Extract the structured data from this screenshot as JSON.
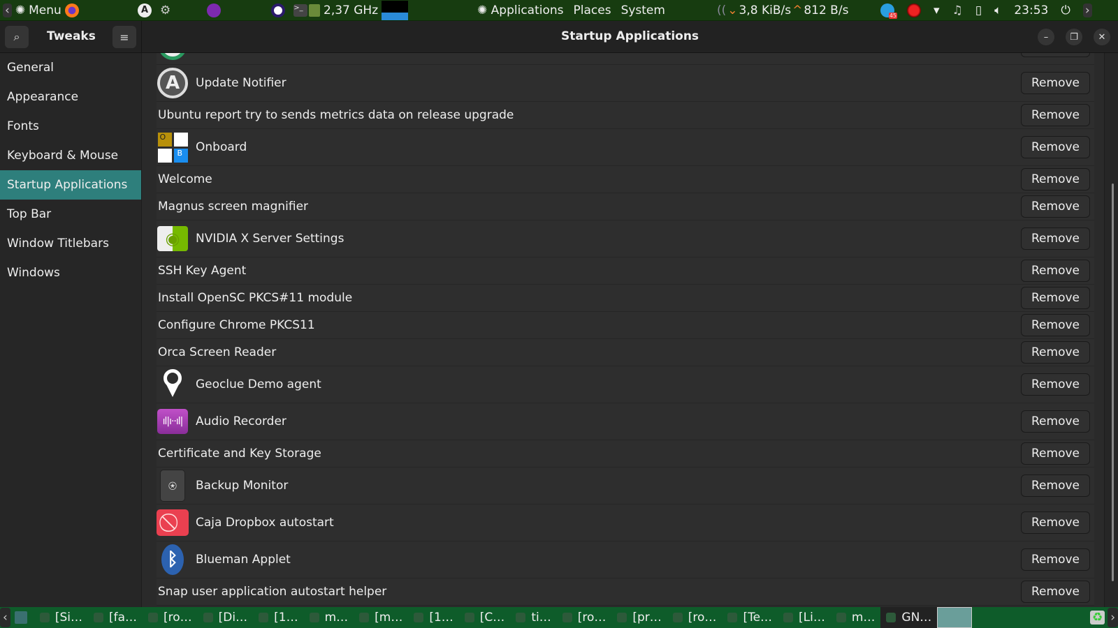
{
  "topbar": {
    "menu_label": "Menu",
    "cpu_freq": "2,37 GHz",
    "applications_label": "Applications",
    "places_label": "Places",
    "system_label": "System",
    "net_down": "3,8 KiB/s",
    "net_up": "812 B/s",
    "notif_badge": "45",
    "clock": "23:53"
  },
  "header": {
    "app_title": "Tweaks",
    "window_title": "Startup Applications"
  },
  "sidebar": {
    "items": [
      {
        "label": "General"
      },
      {
        "label": "Appearance"
      },
      {
        "label": "Fonts"
      },
      {
        "label": "Keyboard & Mouse"
      },
      {
        "label": "Startup Applications",
        "selected": true
      },
      {
        "label": "Top Bar"
      },
      {
        "label": "Window Titlebars"
      },
      {
        "label": "Windows"
      }
    ]
  },
  "startup_apps": {
    "remove_label": "Remove",
    "items": [
      {
        "name": "",
        "icon": "green-circle-icon"
      },
      {
        "name": "Update Notifier",
        "icon": "update-notifier-icon"
      },
      {
        "name": "Ubuntu report try to sends metrics data on release upgrade",
        "icon": ""
      },
      {
        "name": "Onboard",
        "icon": "onboard-icon"
      },
      {
        "name": "Welcome",
        "icon": ""
      },
      {
        "name": "Magnus screen magnifier",
        "icon": ""
      },
      {
        "name": "NVIDIA X Server Settings",
        "icon": "nvidia-icon"
      },
      {
        "name": "SSH Key Agent",
        "icon": ""
      },
      {
        "name": "Install OpenSC PKCS#11 module",
        "icon": ""
      },
      {
        "name": "Configure Chrome PKCS11",
        "icon": ""
      },
      {
        "name": "Orca Screen Reader",
        "icon": ""
      },
      {
        "name": "Geoclue Demo agent",
        "icon": "location-pin-icon"
      },
      {
        "name": "Audio Recorder",
        "icon": "audio-recorder-icon"
      },
      {
        "name": "Certificate and Key Storage",
        "icon": ""
      },
      {
        "name": "Backup Monitor",
        "icon": "backup-monitor-icon"
      },
      {
        "name": "Caja Dropbox autostart",
        "icon": "caja-dropbox-icon"
      },
      {
        "name": "Blueman Applet",
        "icon": "bluetooth-icon"
      },
      {
        "name": "Snap user application autostart helper",
        "icon": ""
      }
    ]
  },
  "taskbar": {
    "tasks": [
      {
        "label": "[Si…"
      },
      {
        "label": "[fa…"
      },
      {
        "label": "[ro…"
      },
      {
        "label": "[Di…"
      },
      {
        "label": "[1…"
      },
      {
        "label": "m…"
      },
      {
        "label": "[m…"
      },
      {
        "label": "[1…"
      },
      {
        "label": "[C…"
      },
      {
        "label": "ti…"
      },
      {
        "label": "[ro…"
      },
      {
        "label": "[pr…"
      },
      {
        "label": "[ro…"
      },
      {
        "label": "[Te…"
      },
      {
        "label": "[Li…"
      },
      {
        "label": "m…"
      },
      {
        "label": "GN…",
        "active": true
      }
    ]
  },
  "colors": {
    "accent": "#2e7f7c",
    "topbar": "#173c10",
    "taskbar": "#0e5c2a"
  }
}
